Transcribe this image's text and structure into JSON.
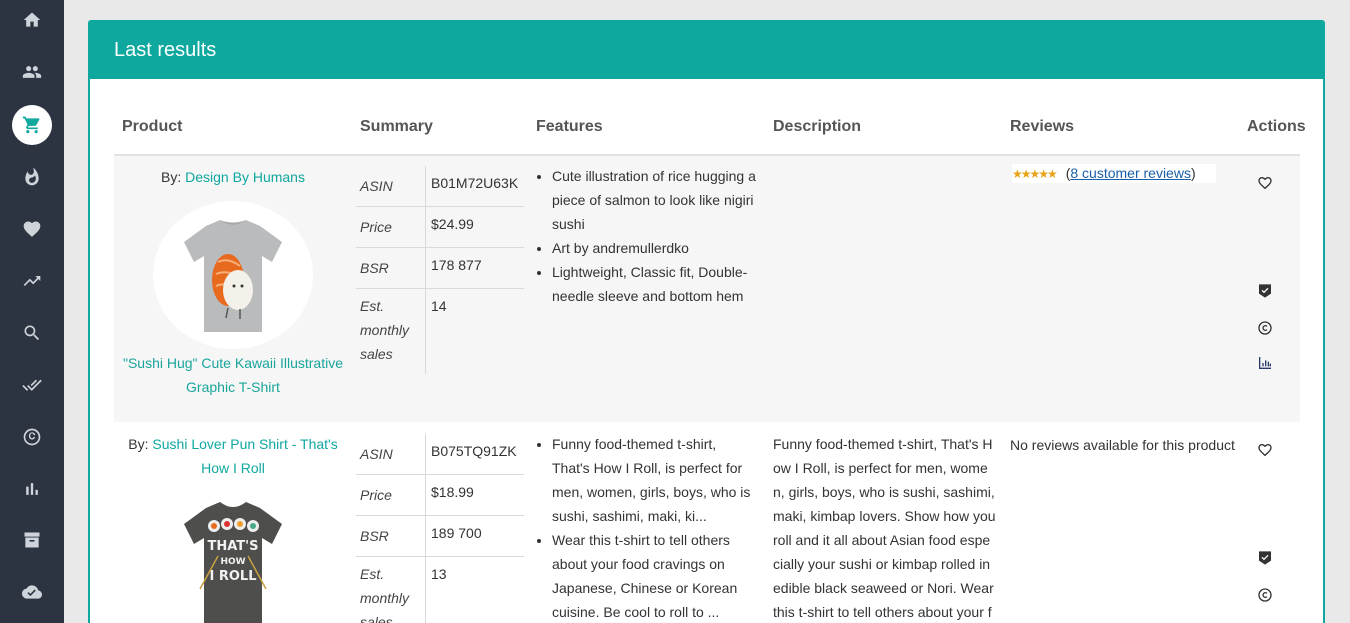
{
  "sidebar": {
    "items": [
      {
        "icon": "home-icon"
      },
      {
        "icon": "users-icon"
      },
      {
        "icon": "cart-icon",
        "active": true
      },
      {
        "icon": "fire-icon"
      },
      {
        "icon": "heart-icon"
      },
      {
        "icon": "trending-icon"
      },
      {
        "icon": "search-icon"
      },
      {
        "icon": "double-check-icon"
      },
      {
        "icon": "copyright-icon"
      },
      {
        "icon": "bar-chart-icon"
      },
      {
        "icon": "archive-icon"
      },
      {
        "icon": "cloud-check-icon"
      }
    ]
  },
  "panel": {
    "title": "Last results",
    "columns": [
      "Product",
      "Summary",
      "Features",
      "Description",
      "Reviews",
      "Actions"
    ]
  },
  "rows": [
    {
      "by_label": "By:",
      "brand": "Design By Humans",
      "product_title": "\"Sushi Hug\" Cute Kawaii Illustrative Graphic T-Shirt",
      "summary": {
        "asin_label": "ASIN",
        "asin": "B01M72U63K",
        "price_label": "Price",
        "price": "$24.99",
        "bsr_label": "BSR",
        "bsr": "178 877",
        "sales_label": "Est. monthly sales",
        "sales": "14"
      },
      "features": [
        "Cute illustration of rice hugging a piece of salmon to look like nigiri sushi",
        "Art by andremullerdko",
        "Lightweight, Classic fit, Double-needle sleeve and bottom hem"
      ],
      "description": "",
      "reviews": {
        "stars": "★★★★★",
        "link_text": "8 customer reviews"
      }
    },
    {
      "by_label": "By:",
      "brand": "Sushi Lover Pun Shirt - That's How I Roll",
      "summary": {
        "asin_label": "ASIN",
        "asin": "B075TQ91ZK",
        "price_label": "Price",
        "price": "$18.99",
        "bsr_label": "BSR",
        "bsr": "189 700",
        "sales_label": "Est. monthly sales",
        "sales": "13"
      },
      "features": [
        "Funny food-themed t-shirt, That's How I Roll, is perfect for men, women, girls, boys, who is sushi, sashimi, maki, ki...",
        "Wear this t-shirt to tell others about your food cravings on Japanese, Chinese or Korean cuisine. Be cool to roll to ..."
      ],
      "description": "Funny food-themed t-shirt, That's How I Roll, is perfect for men, women, girls, boys, who is sushi, sashimi, maki, kimbap lovers. Show how you roll and it all about Asian food especially your sushi or kimbap rolled in edible black seaweed or Nori. Wear this t-shirt to tell others about your food cravings on",
      "reviews": {
        "none_text": "No reviews available for this product"
      }
    }
  ],
  "colors": {
    "accent": "#0ea89f",
    "sidebar": "#2d3441",
    "row_alt": "#f5f6f5"
  }
}
